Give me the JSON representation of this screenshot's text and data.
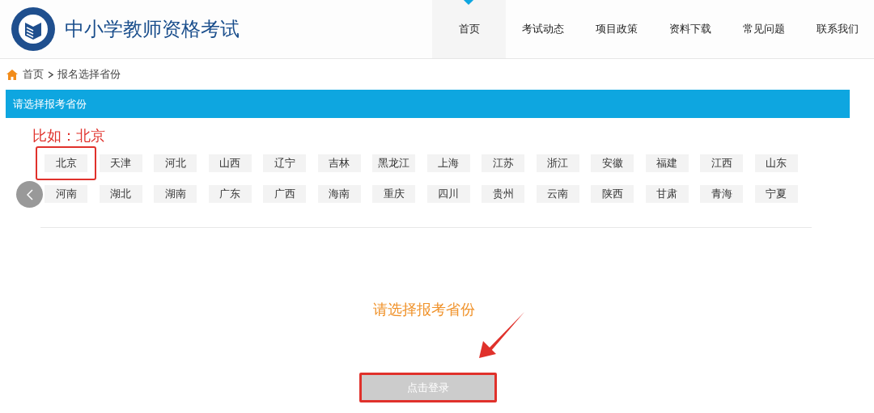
{
  "site": {
    "title": "中小学教师资格考试"
  },
  "nav": [
    {
      "label": "首页",
      "selected": true
    },
    {
      "label": "考试动态",
      "selected": false
    },
    {
      "label": "项目政策",
      "selected": false
    },
    {
      "label": "资料下载",
      "selected": false
    },
    {
      "label": "常见问题",
      "selected": false
    },
    {
      "label": "联系我们",
      "selected": false
    }
  ],
  "breadcrumb": [
    "首页",
    "报名选择省份"
  ],
  "panel": {
    "title": "请选择报考省份",
    "example": "比如：北京"
  },
  "provinces": [
    [
      {
        "label": "北京",
        "highlighted": true
      },
      {
        "label": "天津",
        "highlighted": false
      },
      {
        "label": "河北",
        "highlighted": false
      },
      {
        "label": "山西",
        "highlighted": false
      },
      {
        "label": "辽宁",
        "highlighted": false
      },
      {
        "label": "吉林",
        "highlighted": false
      },
      {
        "label": "黑龙江",
        "highlighted": false
      },
      {
        "label": "上海",
        "highlighted": false
      },
      {
        "label": "江苏",
        "highlighted": false
      },
      {
        "label": "浙江",
        "highlighted": false
      },
      {
        "label": "安徽",
        "highlighted": false
      },
      {
        "label": "福建",
        "highlighted": false
      },
      {
        "label": "江西",
        "highlighted": false
      },
      {
        "label": "山东",
        "highlighted": false
      }
    ],
    [
      {
        "label": "河南",
        "highlighted": false
      },
      {
        "label": "湖北",
        "highlighted": false
      },
      {
        "label": "湖南",
        "highlighted": false
      },
      {
        "label": "广东",
        "highlighted": false
      },
      {
        "label": "广西",
        "highlighted": false
      },
      {
        "label": "海南",
        "highlighted": false
      },
      {
        "label": "重庆",
        "highlighted": false
      },
      {
        "label": "四川",
        "highlighted": false
      },
      {
        "label": "贵州",
        "highlighted": false
      },
      {
        "label": "云南",
        "highlighted": false
      },
      {
        "label": "陕西",
        "highlighted": false
      },
      {
        "label": "甘肃",
        "highlighted": false
      },
      {
        "label": "青海",
        "highlighted": false
      },
      {
        "label": "宁夏",
        "highlighted": false
      }
    ]
  ],
  "prompt": "请选择报考省份",
  "login_button": {
    "label": "点击登录",
    "disabled": true,
    "highlighted": true
  }
}
